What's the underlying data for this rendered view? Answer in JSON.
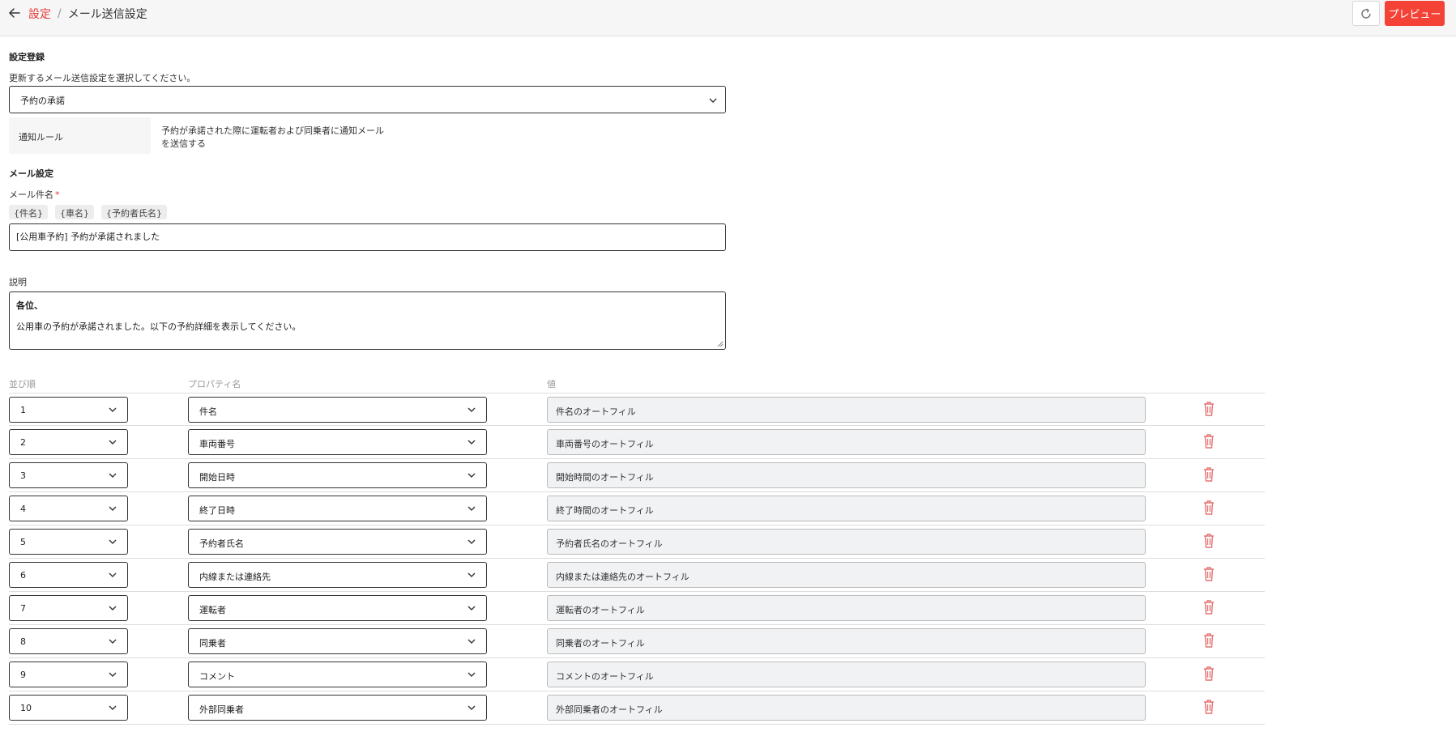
{
  "header": {
    "breadcrumb_link": "設定",
    "breadcrumb_sep": "/",
    "breadcrumb_current": "メール送信設定",
    "preview_label": "プレビュー"
  },
  "settings": {
    "section_title": "設定登録",
    "select_instruction": "更新するメール送信設定を選択してください。",
    "selected_setting": "予約の承諾",
    "rule_label": "通知ルール",
    "rule_description": "予約が承諾された際に運転者および同乗者に通知メールを送信する"
  },
  "mail": {
    "section_title": "メール設定",
    "subject_label": "メール件名",
    "required_mark": "*",
    "chips": [
      "{件名}",
      "{車名}",
      "{予約者氏名}"
    ],
    "subject_value": "[公用車予約] 予約が承諾されました",
    "description_label": "説明",
    "description_line1": "各位、",
    "description_line2": "公用車の予約が承諾されました。以下の予約詳細を表示してください。"
  },
  "table": {
    "headers": {
      "order": "並び順",
      "property": "プロパティ名",
      "value": "値"
    },
    "rows": [
      {
        "order": "1",
        "property": "件名",
        "value": "件名のオートフィル"
      },
      {
        "order": "2",
        "property": "車両番号",
        "value": "車両番号のオートフィル"
      },
      {
        "order": "3",
        "property": "開始日時",
        "value": "開始時間のオートフィル"
      },
      {
        "order": "4",
        "property": "終了日時",
        "value": "終了時間のオートフィル"
      },
      {
        "order": "5",
        "property": "予約者氏名",
        "value": "予約者氏名のオートフィル"
      },
      {
        "order": "6",
        "property": "内線または連絡先",
        "value": "内線または連絡先のオートフィル"
      },
      {
        "order": "7",
        "property": "運転者",
        "value": "運転者のオートフィル"
      },
      {
        "order": "8",
        "property": "同乗者",
        "value": "同乗者のオートフィル"
      },
      {
        "order": "9",
        "property": "コメント",
        "value": "コメントのオートフィル"
      },
      {
        "order": "10",
        "property": "外部同乗者",
        "value": "外部同乗者のオートフィル"
      }
    ]
  },
  "colors": {
    "accent": "#f44336",
    "link": "#e53935",
    "trash": "#e57373"
  },
  "icons": {
    "back": "arrow-left-icon",
    "refresh": "refresh-icon",
    "dropdown": "chevron-down-icon",
    "delete": "trash-icon"
  }
}
